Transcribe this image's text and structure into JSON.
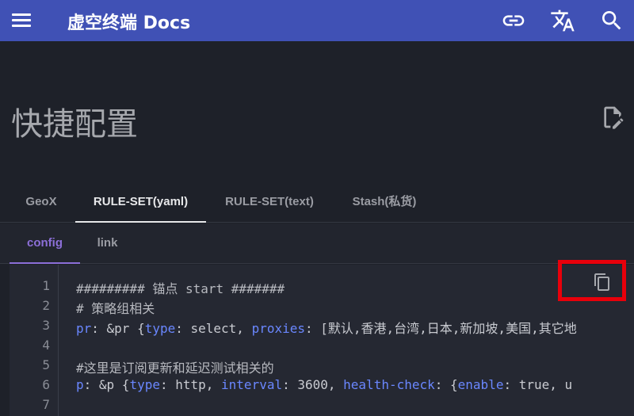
{
  "header": {
    "site_title": "虚空终端 Docs",
    "icons": [
      "menu-icon",
      "link-icon",
      "translate-icon",
      "search-icon"
    ]
  },
  "page": {
    "title": "快捷配置",
    "edit_icon": "edit-page-icon"
  },
  "tabs": [
    {
      "label": "GeoX",
      "active": false
    },
    {
      "label": "RULE-SET(yaml)",
      "active": true
    },
    {
      "label": "RULE-SET(text)",
      "active": false
    },
    {
      "label": "Stash(私货)",
      "active": false
    }
  ],
  "subtabs": [
    {
      "label": "config",
      "active": true
    },
    {
      "label": "link",
      "active": false
    }
  ],
  "code": {
    "line_numbers": [
      "1",
      "2",
      "3",
      "4",
      "5",
      "6",
      "7"
    ],
    "lines": [
      "######### 锚点 start #######",
      "# 策略组相关",
      "pr: &pr {type: select, proxies: [默认,香港,台湾,日本,新加坡,美国,其它地",
      "",
      "#这里是订阅更新和延迟测试相关的",
      "p: &p {type: http, interval: 3600, health-check: {enable: true, u",
      ""
    ],
    "copy_icon": "copy-icon"
  },
  "colors": {
    "header_bg": "#4051b5",
    "page_bg": "#1e2129",
    "active_subtab": "#8c6fd8",
    "highlight_box": "#e8000b"
  }
}
